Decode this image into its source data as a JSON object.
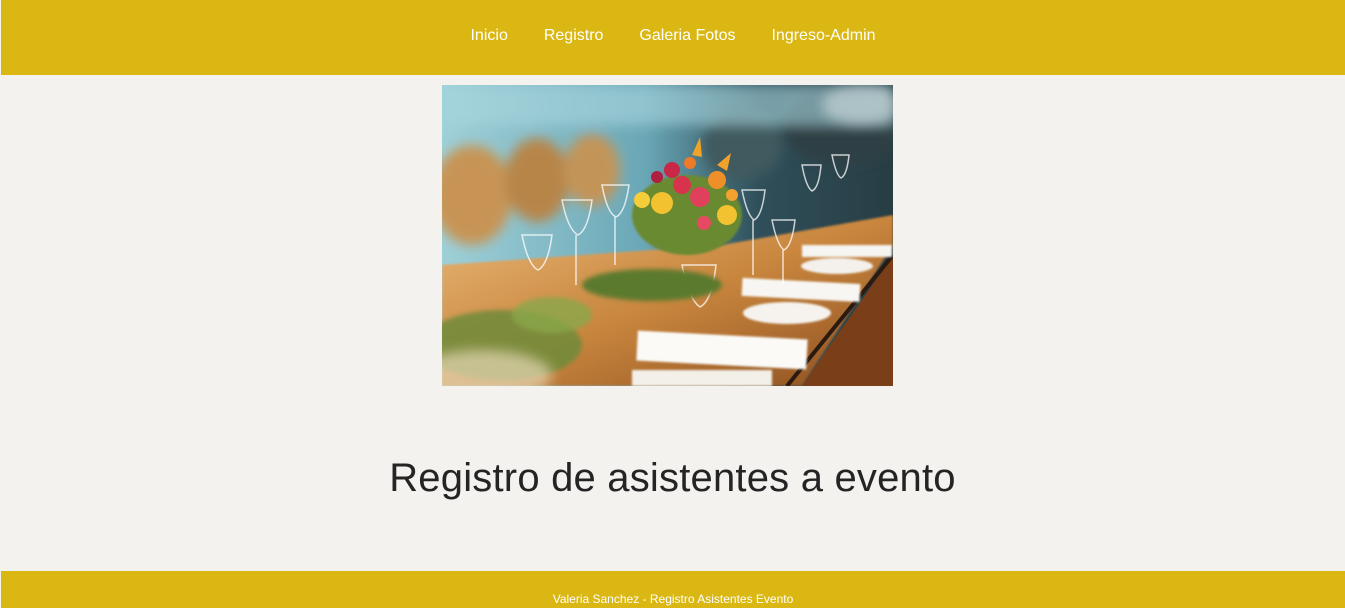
{
  "nav": {
    "items": [
      {
        "label": "Inicio"
      },
      {
        "label": "Registro"
      },
      {
        "label": "Galeria Fotos"
      },
      {
        "label": "Ingreso-Admin"
      }
    ]
  },
  "hero": {
    "image_subject": "banquet-table-with-flowers"
  },
  "main": {
    "title": "Registro de asistentes a evento"
  },
  "footer": {
    "text": "Valeria Sanchez - Registro Asistentes Evento"
  },
  "colors": {
    "accent": "#dab713",
    "background": "#f3f2ef",
    "title_text": "#242424",
    "nav_text": "#ffffff"
  }
}
